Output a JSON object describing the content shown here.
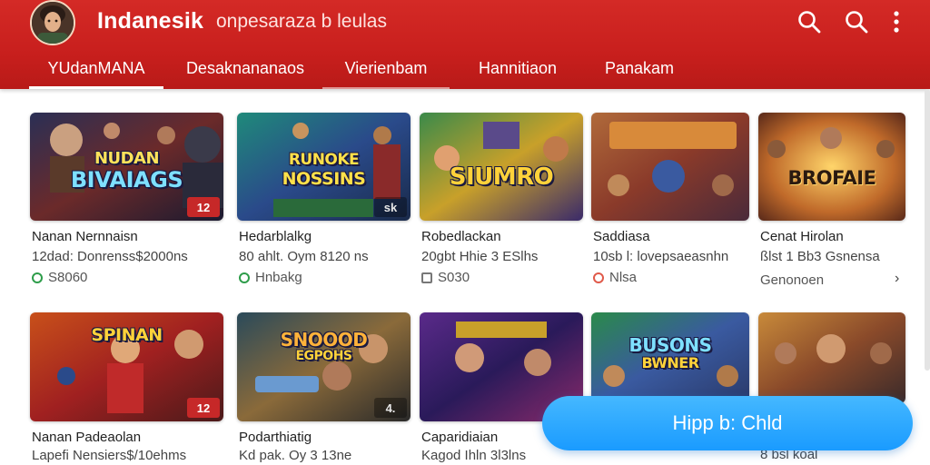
{
  "header": {
    "title": "Indanesik",
    "subtitle": "onpesaraza b leulas",
    "icons": [
      "search-icon",
      "search-icon",
      "more-vert-icon"
    ],
    "brand_color": "#c8201d"
  },
  "tabs": [
    {
      "label": "YUdanMANA",
      "active": true
    },
    {
      "label": "Desaknananaos",
      "active": false
    },
    {
      "label": "Vierienbam",
      "active": false
    },
    {
      "label": "Hannitiaon",
      "active": false
    },
    {
      "label": "Panakam",
      "active": false
    }
  ],
  "row1": [
    {
      "thumb_text": "BIVAIAGS",
      "thumb_text2": "NUDAN",
      "badge": "12",
      "title": "Nanan Nernnaisn",
      "meta": "12dad: Donrenss$2000ns",
      "foot": "S8060",
      "foot_icon": "green"
    },
    {
      "thumb_text": "NOSSINS",
      "thumb_text2": "RUNOKE",
      "badge": "sk",
      "title": "Hedarblalkg",
      "meta": "80 ahlt. Oym 8120 ns",
      "foot": "Hnbakg",
      "foot_icon": "green"
    },
    {
      "thumb_text": "SIUMRO",
      "thumb_text2": "",
      "badge": "",
      "title": "Robedlackan",
      "meta": "20gbt Hhie 3 ESlhs",
      "foot": "S030",
      "foot_icon": "grey"
    },
    {
      "thumb_text": "",
      "thumb_text2": "",
      "badge": "",
      "title": "Saddiasa",
      "meta": "10sb l: lovepsaeasnhn",
      "foot": "Nlsa",
      "foot_icon": "red"
    },
    {
      "thumb_text": "BROFAIE",
      "thumb_text2": "",
      "badge": "",
      "title": "Cenat Hirolan",
      "meta": "ßlst 1 Bb3 Gsnensa",
      "foot": "Genonoen",
      "foot_icon": ""
    }
  ],
  "row2": [
    {
      "thumb_text": "SPINAN",
      "thumb_text2": "",
      "badge": "12",
      "title": "Nanan Padeaolan",
      "meta": "Lapefi Nensiers$/10ehms",
      "foot": "",
      "foot_icon": ""
    },
    {
      "thumb_text": "SNOOOD",
      "thumb_text2": "EGPOHS",
      "badge": "4.",
      "title": "Podarthiatig",
      "meta": "Kd pak. Oy 3 13ne",
      "foot": "",
      "foot_icon": ""
    },
    {
      "thumb_text": "",
      "thumb_text2": "",
      "badge": "",
      "title": "Caparidiaian",
      "meta": "Kagod Ihln 3l3lns",
      "foot": "",
      "foot_icon": ""
    },
    {
      "thumb_text": "BUSONS",
      "thumb_text2": "BWNER",
      "badge": "",
      "title": "",
      "meta": "",
      "foot": "",
      "foot_icon": ""
    },
    {
      "thumb_text": "",
      "thumb_text2": "",
      "badge": "",
      "title": "",
      "meta": "8 bsl koal",
      "foot": "",
      "foot_icon": ""
    }
  ],
  "fab": {
    "label": "Hipp b: Chld"
  }
}
